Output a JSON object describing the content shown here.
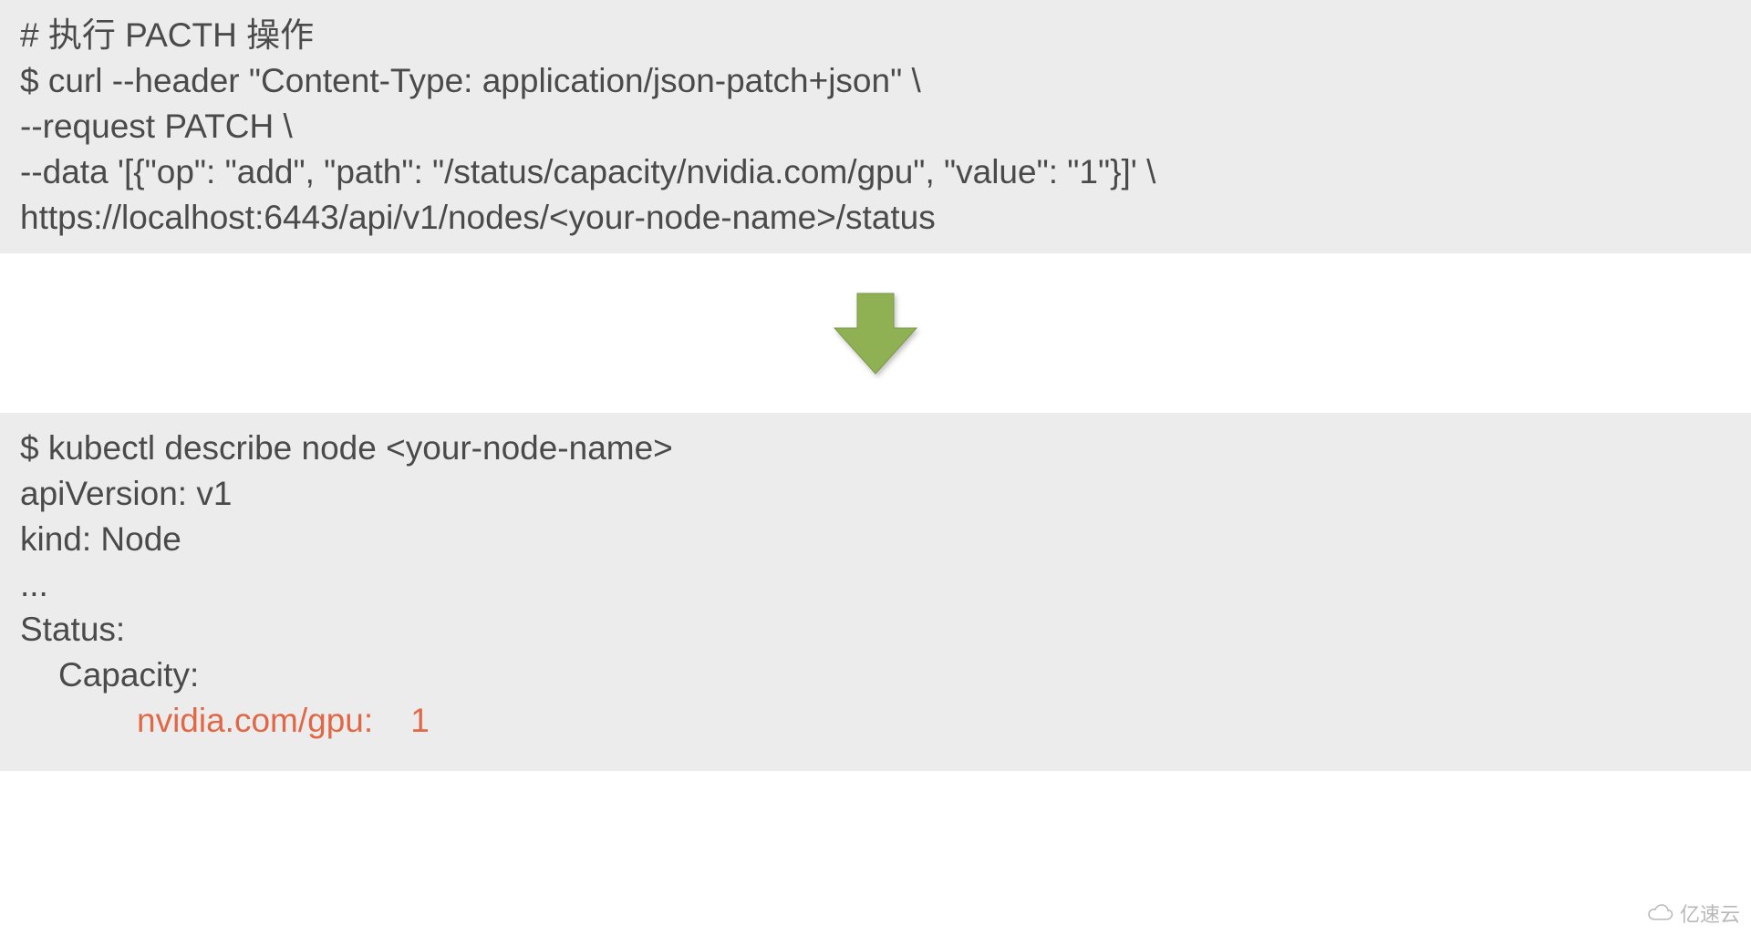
{
  "block1": {
    "line1": "# 执行 PACTH 操作",
    "line2": "$ curl --header \"Content-Type: application/json-patch+json\" \\",
    "line3": "--request PATCH \\",
    "line4": "--data '[{\"op\": \"add\", \"path\": \"/status/capacity/nvidia.com/gpu\", \"value\": \"1\"}]' \\",
    "line5": "https://localhost:6443/api/v1/nodes/<your-node-name>/status"
  },
  "block2": {
    "line1": "$ kubectl describe node <your-node-name>",
    "line2": "apiVersion: v1",
    "line3": "kind: Node",
    "line4": "...",
    "line5": "Status:",
    "line6": "Capacity:",
    "line7_key": "nvidia.com/gpu:",
    "line7_val": "1"
  },
  "watermark_text": "亿速云",
  "arrow_color": "#8fb153"
}
